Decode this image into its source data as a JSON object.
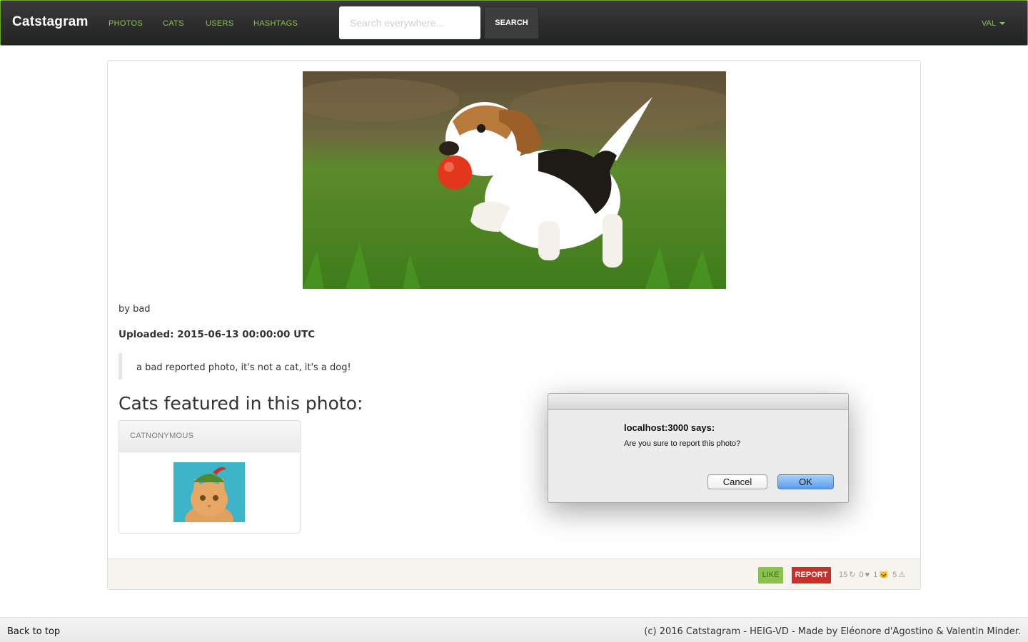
{
  "navbar": {
    "brand": "Catstagram",
    "links": [
      "PHOTOS",
      "CATS",
      "USERS",
      "HASHTAGS"
    ],
    "search_placeholder": "Search everywhere...",
    "search_button": "SEARCH",
    "user": "VAL"
  },
  "photo": {
    "by": "by bad",
    "uploaded": "Uploaded: 2015-06-13 00:00:00 UTC",
    "description": "a bad reported photo, it's not a cat, it's a dog!",
    "cats_title": "Cats featured in this photo:"
  },
  "cat_card": {
    "name": "CATNONYMOUS"
  },
  "actions": {
    "like": "LIKE",
    "report": "REPORT",
    "views": "15",
    "reposts": "0",
    "likes": "1",
    "cats": "5"
  },
  "dialog": {
    "title": "localhost:3000 says:",
    "message": "Are you sure to report this photo?",
    "cancel": "Cancel",
    "ok": "OK"
  },
  "footer": {
    "back_to_top": "Back to top",
    "credits_prefix": "(c) 2016 Catstagram - HEIG-VD - Made by ",
    "author1": "Eléonore d'Agostino",
    "amp": " & ",
    "author2": "Valentin Minder",
    "credits_suffix": "."
  },
  "colors": {
    "accent": "#8cc152",
    "danger": "#c9302c",
    "navbar": "#2a2a2a"
  }
}
